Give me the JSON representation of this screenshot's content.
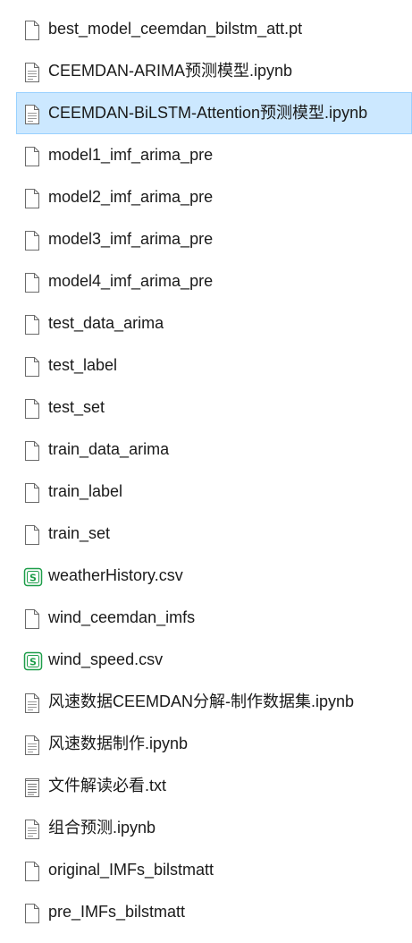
{
  "files": [
    {
      "name": "best_model_ceemdan_bilstm_att.pt",
      "icon": "blank-file-icon",
      "selected": false
    },
    {
      "name": "CEEMDAN-ARIMA预测模型.ipynb",
      "icon": "text-file-icon",
      "selected": false
    },
    {
      "name": "CEEMDAN-BiLSTM-Attention预测模型.ipynb",
      "icon": "text-file-icon",
      "selected": true
    },
    {
      "name": "model1_imf_arima_pre",
      "icon": "blank-file-icon",
      "selected": false
    },
    {
      "name": "model2_imf_arima_pre",
      "icon": "blank-file-icon",
      "selected": false
    },
    {
      "name": "model3_imf_arima_pre",
      "icon": "blank-file-icon",
      "selected": false
    },
    {
      "name": "model4_imf_arima_pre",
      "icon": "blank-file-icon",
      "selected": false
    },
    {
      "name": "test_data_arima",
      "icon": "blank-file-icon",
      "selected": false
    },
    {
      "name": "test_label",
      "icon": "blank-file-icon",
      "selected": false
    },
    {
      "name": "test_set",
      "icon": "blank-file-icon",
      "selected": false
    },
    {
      "name": "train_data_arima",
      "icon": "blank-file-icon",
      "selected": false
    },
    {
      "name": "train_label",
      "icon": "blank-file-icon",
      "selected": false
    },
    {
      "name": "train_set",
      "icon": "blank-file-icon",
      "selected": false
    },
    {
      "name": "weatherHistory.csv",
      "icon": "spreadsheet-file-icon",
      "selected": false
    },
    {
      "name": "wind_ceemdan_imfs",
      "icon": "blank-file-icon",
      "selected": false
    },
    {
      "name": "wind_speed.csv",
      "icon": "spreadsheet-file-icon",
      "selected": false
    },
    {
      "name": "风速数据CEEMDAN分解-制作数据集.ipynb",
      "icon": "text-file-icon",
      "selected": false
    },
    {
      "name": "风速数据制作.ipynb",
      "icon": "text-file-icon",
      "selected": false
    },
    {
      "name": "文件解读必看.txt",
      "icon": "notepad-file-icon",
      "selected": false
    },
    {
      "name": "组合预测.ipynb",
      "icon": "text-file-icon",
      "selected": false
    },
    {
      "name": "original_IMFs_bilstmatt",
      "icon": "blank-file-icon",
      "selected": false
    },
    {
      "name": "pre_IMFs_bilstmatt",
      "icon": "blank-file-icon",
      "selected": false
    }
  ],
  "colors": {
    "selected_background": "#cce8ff",
    "selected_border": "#99d1ff",
    "spreadsheet_accent": "#1e9e4a",
    "text": "#1a1a1a"
  }
}
